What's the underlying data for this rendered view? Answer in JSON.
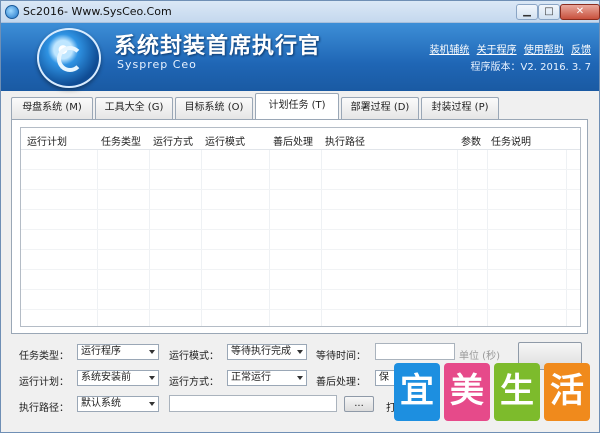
{
  "window": {
    "title": "Sc2016- Www.SysCeo.Com",
    "minimize": "▁",
    "maximize": "□",
    "close": "✕"
  },
  "banner": {
    "title": "系统封装首席执行官",
    "subtitle": "Sysprep Ceo",
    "links": [
      "装机辅统",
      "关于程序",
      "使用帮助",
      "反馈"
    ],
    "version": "程序版本：V2. 2016. 3. 7"
  },
  "tabs": [
    "母盘系统 (M)",
    "工具大全 (G)",
    "目标系统 (O)",
    "计划任务 (T)",
    "部署过程 (D)",
    "封装过程 (P)"
  ],
  "active_tab": "计划任务 (T)",
  "list": {
    "columns": [
      "运行计划",
      "任务类型",
      "运行方式",
      "运行模式",
      "善后处理",
      "执行路径",
      "参数",
      "任务说明"
    ]
  },
  "form": {
    "task_type_label": "任务类型：",
    "task_type_value": "运行程序",
    "run_mode_label": "运行模式：",
    "run_mode_value": "等待执行完成",
    "wait_time_label": "等待时间：",
    "wait_time_value": "",
    "unit_label": "单位 (秒)",
    "run_plan_label": "运行计划：",
    "run_plan_value": "系统安装前",
    "run_method_label": "运行方式：",
    "run_method_value": "正常运行",
    "cleanup_label": "善后处理：",
    "cleanup_value": "保",
    "exec_path_label": "执行路径：",
    "exec_path_value": "默认系统",
    "path_input_value": "",
    "browse_label": "...",
    "param_label_partial": "打"
  },
  "watermark": {
    "chars": [
      "宜",
      "美",
      "生",
      "活"
    ],
    "colors": [
      "#1d8fe0",
      "#e64a8a",
      "#7dbb2c",
      "#f08a1c"
    ]
  }
}
